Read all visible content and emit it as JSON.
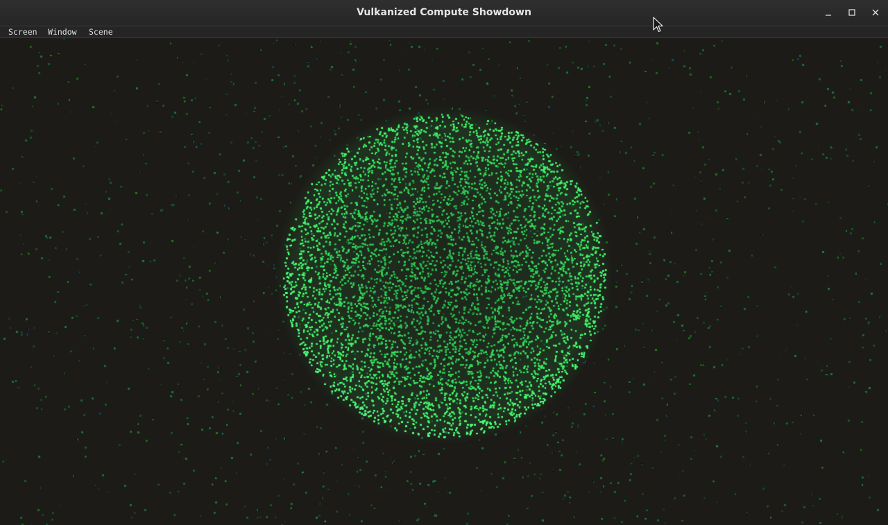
{
  "window": {
    "title": "Vulkanized Compute Showdown"
  },
  "controls": {
    "minimize_icon": "minimize-icon",
    "maximize_icon": "maximize-icon",
    "close_icon": "close-icon"
  },
  "menu": {
    "items": [
      "Screen",
      "Window",
      "Scene"
    ]
  },
  "scene": {
    "background_color": "#1c1b17",
    "particle_color_bright": "#3aff6a",
    "particle_color_dim": "#1f6a4a",
    "description_colors": [
      "#27c45a",
      "#1f7a5a",
      "#3b8a2a"
    ]
  }
}
